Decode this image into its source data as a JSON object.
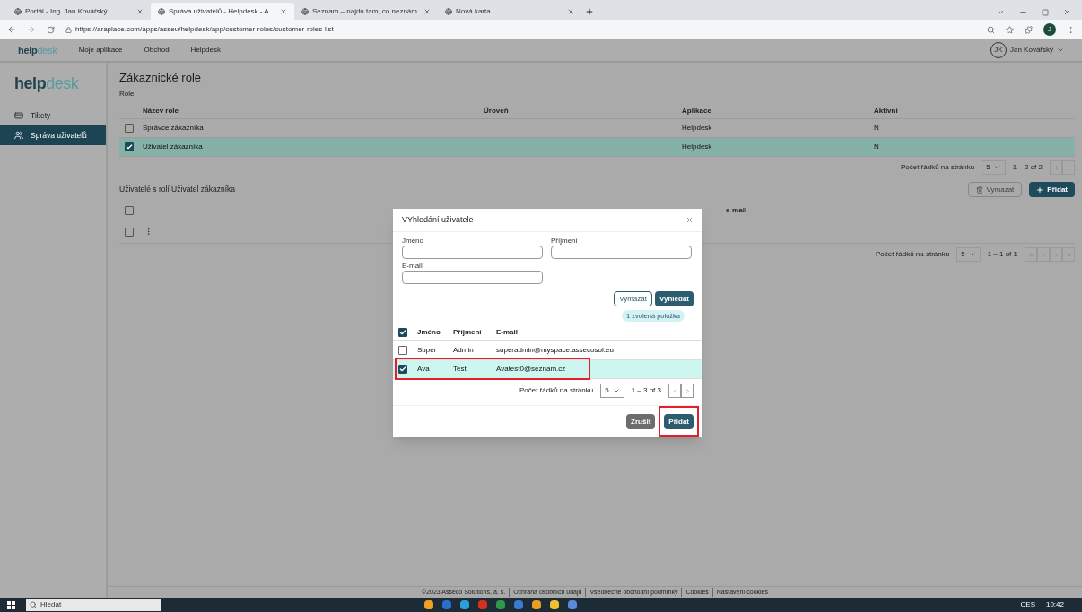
{
  "browser": {
    "tabs": [
      {
        "title": "Portál - Ing. Jan Kovářský",
        "selected": false
      },
      {
        "title": "Správa uživatelů - Helpdesk - A",
        "selected": true
      },
      {
        "title": "Seznam – najdu tam, co neznám",
        "selected": false
      },
      {
        "title": "Nová karta",
        "selected": false
      }
    ],
    "url": "https://araplace.com/apps/asseu/helpdesk/app/customer-roles/customer-roles-list",
    "profile_initial": "J"
  },
  "header": {
    "logo": {
      "main": "help",
      "accent": "desk"
    },
    "nav": [
      "Moje aplikace",
      "Obchod",
      "Helpdesk"
    ],
    "user": {
      "initials": "JK",
      "name": "Jan Kovářský"
    }
  },
  "sidebar": {
    "logo": {
      "main": "help",
      "accent": "desk"
    },
    "items": [
      {
        "label": "Tikety",
        "selected": false
      },
      {
        "label": "Správa uživatelů",
        "selected": true
      }
    ]
  },
  "page": {
    "title": "Zákaznické role",
    "roles_label": "Role",
    "roles_table": {
      "columns": [
        "Název role",
        "Úroveň",
        "Aplikace",
        "Aktivní"
      ],
      "rows": [
        {
          "cells": [
            "Správce zákazníka",
            "",
            "Helpdesk",
            "N"
          ],
          "selected": false
        },
        {
          "cells": [
            "Uživatel zákazníka",
            "",
            "Helpdesk",
            "N"
          ],
          "selected": true
        }
      ],
      "pagination": {
        "label": "Počet řádků na stránku",
        "page_size": "5",
        "range": "1 – 2 of 2"
      }
    },
    "users_title": "Uživatelé s rolí Uživatel zákazníka",
    "users_buttons": {
      "clear": "Vymazat",
      "add": "Přidat"
    },
    "users_table": {
      "all_checked": false,
      "columns": [
        "e-mail"
      ],
      "rows": [
        {
          "selected": false
        }
      ],
      "pagination": {
        "label": "Počet řádků na stránku",
        "page_size": "5",
        "range": "1 – 1 of 1"
      }
    }
  },
  "dialog": {
    "title": "VYhledání uživatele",
    "fields": [
      {
        "label": "Jméno"
      },
      {
        "label": "Příjmení"
      },
      {
        "label": "E-mail"
      }
    ],
    "buttons": {
      "clear": "Vymazat",
      "search": "Vyhledat"
    },
    "selection_chip": "1 zvolená položka",
    "table": {
      "all_checked": true,
      "columns": [
        "Jméno",
        "Příjmení",
        "E-mail"
      ],
      "rows": [
        {
          "cells": [
            "Super",
            "Admin",
            "superadmin@myspace.assecosol.eu"
          ],
          "selected": false
        },
        {
          "cells": [
            "Ava",
            "Test",
            "Avatest0@seznam.cz"
          ],
          "selected": true
        }
      ],
      "pagination": {
        "label": "Počet řádků na stránku",
        "page_size": "5",
        "range": "1 – 3 of 3"
      }
    },
    "footer_buttons": {
      "cancel": "Zrušit",
      "add": "Přidat"
    }
  },
  "footer": [
    "©2023 Asseco Solutions, a. s.",
    "Ochrana osobních údajů",
    "Všeobecné obchodní podmínky",
    "Cookies",
    "Nastavení cookies"
  ],
  "taskbar": {
    "search_placeholder": "Hledat",
    "language": "CES",
    "time": "10:42"
  }
}
